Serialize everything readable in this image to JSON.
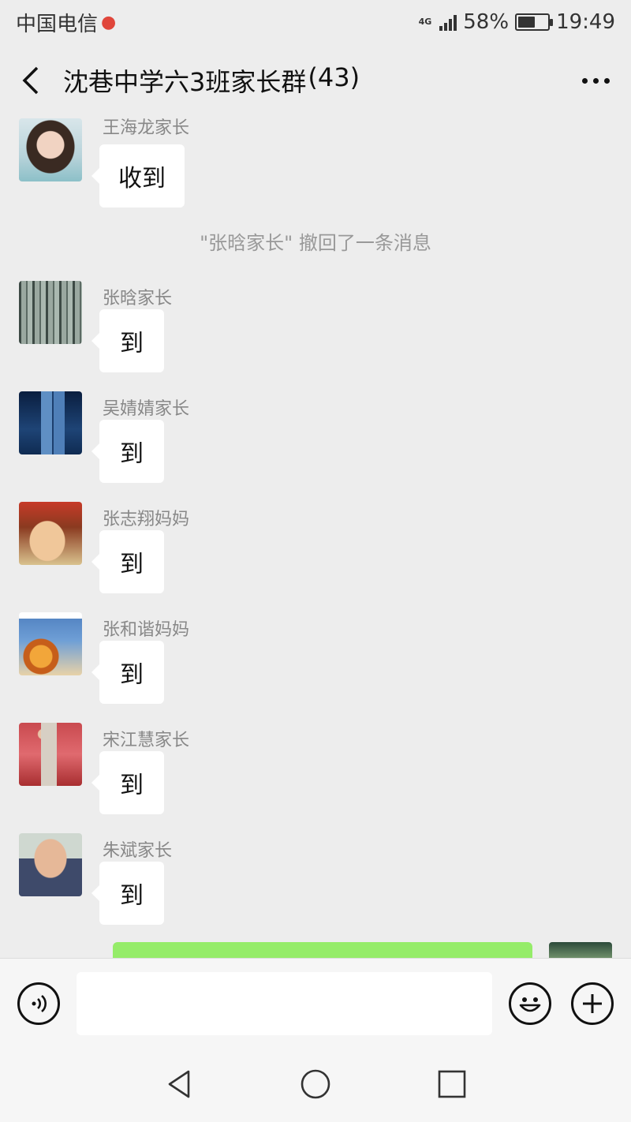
{
  "status_bar": {
    "carrier": "中国电信",
    "network_type": "4G",
    "battery_percent": "58%",
    "battery_level": 0.58,
    "time": "19:49"
  },
  "header": {
    "title": "沈巷中学六3班家长群",
    "member_count": "(43)"
  },
  "messages": [
    {
      "sender": "王海龙家长",
      "text": "收到"
    },
    {
      "sender": "张晗家长",
      "text": "到"
    },
    {
      "sender": "吴婧婧家长",
      "text": "到"
    },
    {
      "sender": "张志翔妈妈",
      "text": "到"
    },
    {
      "sender": "张和谐妈妈",
      "text": "到"
    },
    {
      "sender": "宋江慧家长",
      "text": "到"
    },
    {
      "sender": "朱斌家长",
      "text": "到"
    }
  ],
  "system_notice": "\"张晗家长\" 撤回了一条消息",
  "input": {
    "value": ""
  },
  "icons": {
    "back": "chevron-left-icon",
    "more": "more-icon",
    "voice": "voice-icon",
    "emoji": "emoji-icon",
    "plus": "plus-icon"
  },
  "colors": {
    "background": "#ededed",
    "own_bubble": "#95ec69",
    "other_bubble": "#ffffff"
  }
}
